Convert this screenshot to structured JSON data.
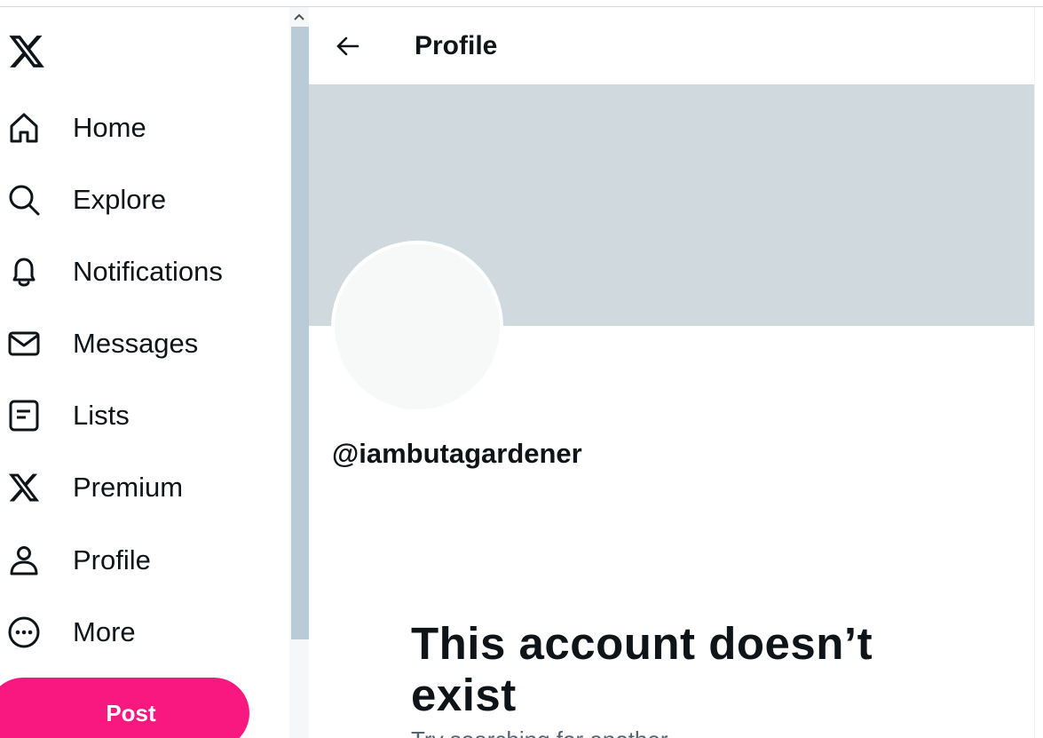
{
  "sidebar": {
    "logo_icon": "x-logo-icon",
    "items": [
      {
        "label": "Home",
        "icon": "home-icon"
      },
      {
        "label": "Explore",
        "icon": "search-icon"
      },
      {
        "label": "Notifications",
        "icon": "bell-icon"
      },
      {
        "label": "Messages",
        "icon": "envelope-icon"
      },
      {
        "label": "Lists",
        "icon": "list-icon"
      },
      {
        "label": "Premium",
        "icon": "x-logo-icon"
      },
      {
        "label": "Profile",
        "icon": "person-icon"
      },
      {
        "label": "More",
        "icon": "more-circle-icon"
      }
    ],
    "post_label": "Post"
  },
  "header": {
    "back_icon": "back-arrow-icon",
    "title": "Profile"
  },
  "profile": {
    "handle": "@iambutagardener"
  },
  "empty_state": {
    "title": "This account doesn’t exist",
    "subtitle": "Try searching for another."
  },
  "colors": {
    "accent": "#f91880",
    "banner": "#cfd9de",
    "avatar": "#f7f9f9",
    "scroll_thumb": "#b9cbd6",
    "text": "#0f1419",
    "secondary_text": "#536471"
  }
}
